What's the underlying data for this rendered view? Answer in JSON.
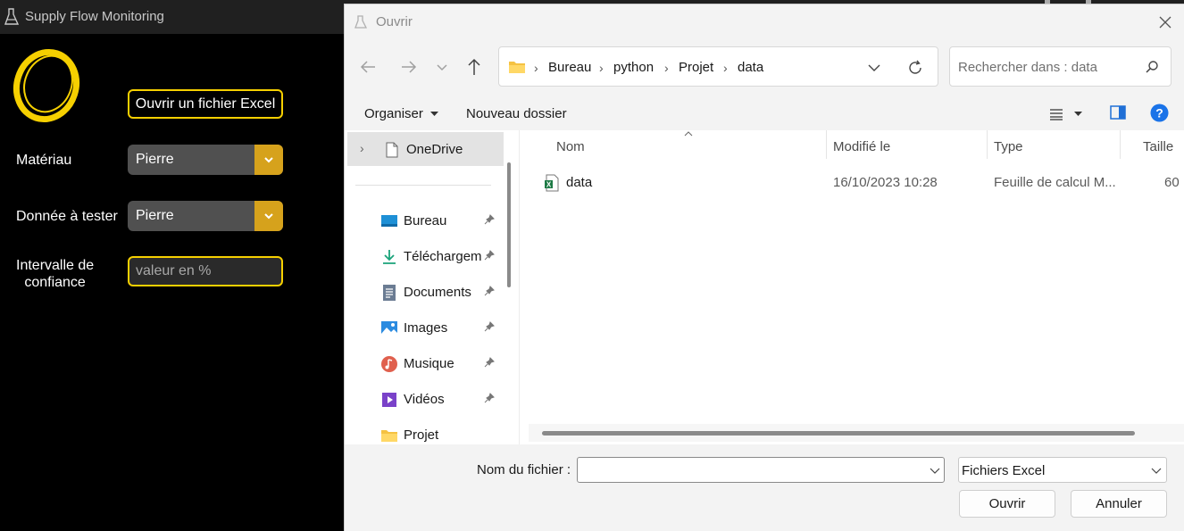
{
  "app": {
    "title": "Supply Flow Monitoring",
    "open_button": "Ouvrir un fichier Excel",
    "material_label": "Matériau",
    "material_value": "Pierre",
    "data_label": "Donnée à tester",
    "data_value": "Pierre",
    "interval_label_line1": "Intervalle de",
    "interval_label_line2": "confiance",
    "interval_placeholder": "valeur en %",
    "accent_color": "#f6d000",
    "dropdown_accent": "#d6a21c"
  },
  "dialog": {
    "title": "Ouvrir",
    "breadcrumb": [
      "Bureau",
      "python",
      "Projet",
      "data"
    ],
    "search_placeholder": "Rechercher dans : data",
    "commands": {
      "organize": "Organiser",
      "new_folder": "Nouveau dossier"
    },
    "nav": {
      "onedrive": "OneDrive",
      "items": [
        {
          "label": "Bureau",
          "icon": "desktop-icon"
        },
        {
          "label": "Téléchargem",
          "icon": "download-icon"
        },
        {
          "label": "Documents",
          "icon": "documents-icon"
        },
        {
          "label": "Images",
          "icon": "images-icon"
        },
        {
          "label": "Musique",
          "icon": "music-icon"
        },
        {
          "label": "Vidéos",
          "icon": "videos-icon"
        },
        {
          "label": "Projet",
          "icon": "folder-icon"
        }
      ]
    },
    "columns": {
      "name": "Nom",
      "modified": "Modifié le",
      "type": "Type",
      "size": "Taille"
    },
    "files": [
      {
        "name": "data",
        "modified": "16/10/2023 10:28",
        "type": "Feuille de calcul M...",
        "size": "60"
      }
    ],
    "filename_label": "Nom du fichier :",
    "filename_value": "",
    "filetype": "Fichiers Excel",
    "open_button": "Ouvrir",
    "cancel_button": "Annuler"
  }
}
